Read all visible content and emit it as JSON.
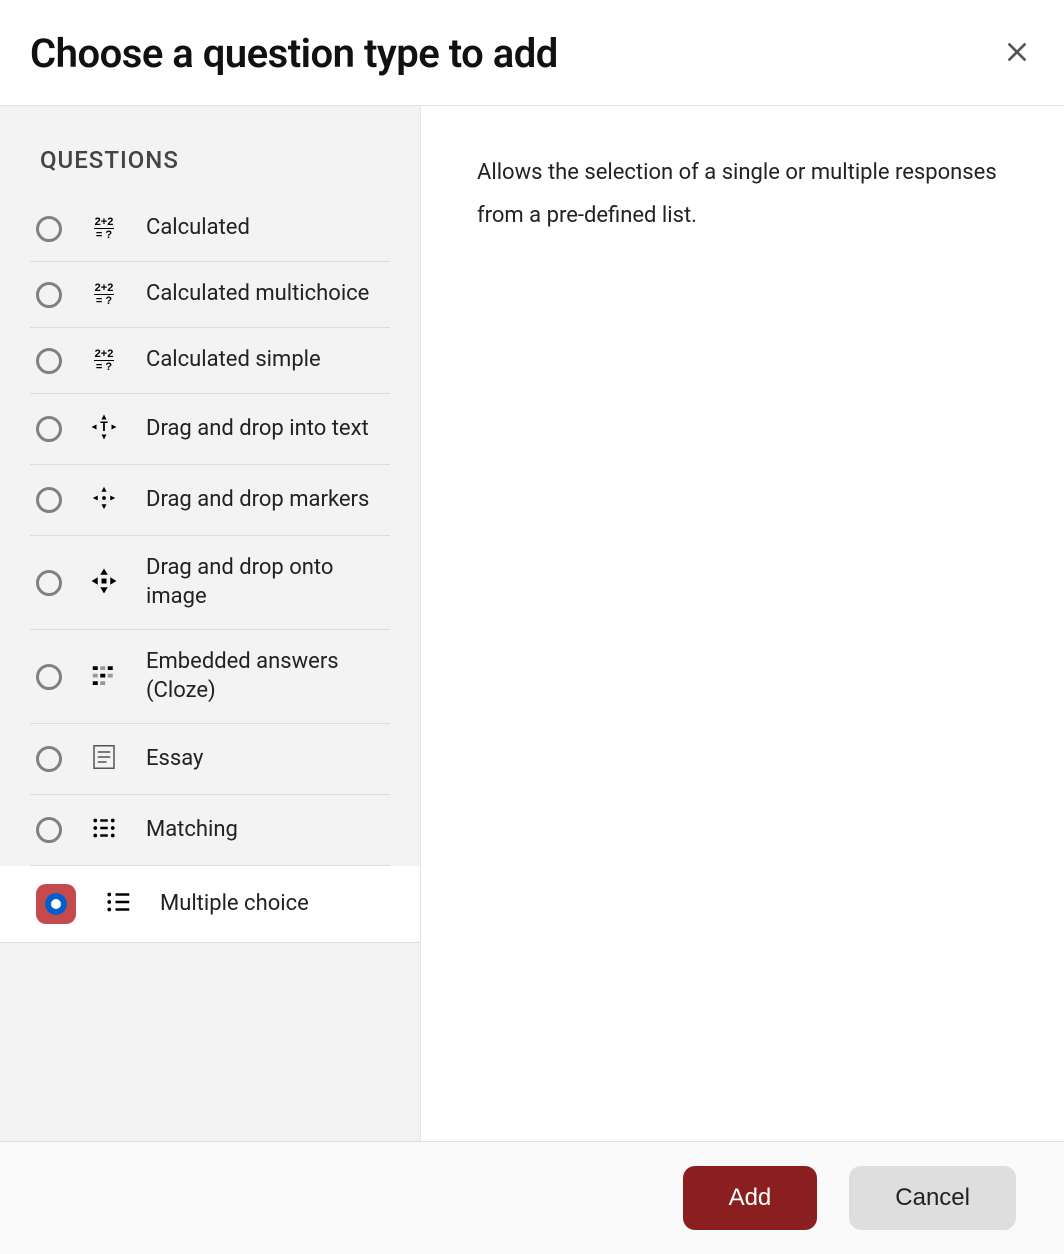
{
  "dialog": {
    "title": "Choose a question type to add",
    "close_aria": "Close"
  },
  "sidebar": {
    "heading": "QUESTIONS",
    "items": [
      {
        "id": "calculated",
        "label": "Calculated",
        "icon": "calc",
        "selected": false
      },
      {
        "id": "calculatedmulti",
        "label": "Calculated multichoice",
        "icon": "calc",
        "selected": false
      },
      {
        "id": "calculatedsimple",
        "label": "Calculated simple",
        "icon": "calc",
        "selected": false
      },
      {
        "id": "ddwtos",
        "label": "Drag and drop into text",
        "icon": "dragtext",
        "selected": false
      },
      {
        "id": "ddmarker",
        "label": "Drag and drop markers",
        "icon": "dragmarkers",
        "selected": false
      },
      {
        "id": "ddimageortext",
        "label": "Drag and drop onto image",
        "icon": "dragimg",
        "selected": false
      },
      {
        "id": "multianswer",
        "label": "Embedded answers (Cloze)",
        "icon": "cloze",
        "selected": false
      },
      {
        "id": "essay",
        "label": "Essay",
        "icon": "essay",
        "selected": false
      },
      {
        "id": "match",
        "label": "Matching",
        "icon": "match",
        "selected": false
      },
      {
        "id": "multichoice",
        "label": "Multiple choice",
        "icon": "mc",
        "selected": true
      }
    ]
  },
  "description": "Allows the selection of a single or multiple responses from a pre-defined list.",
  "footer": {
    "add_label": "Add",
    "cancel_label": "Cancel"
  }
}
